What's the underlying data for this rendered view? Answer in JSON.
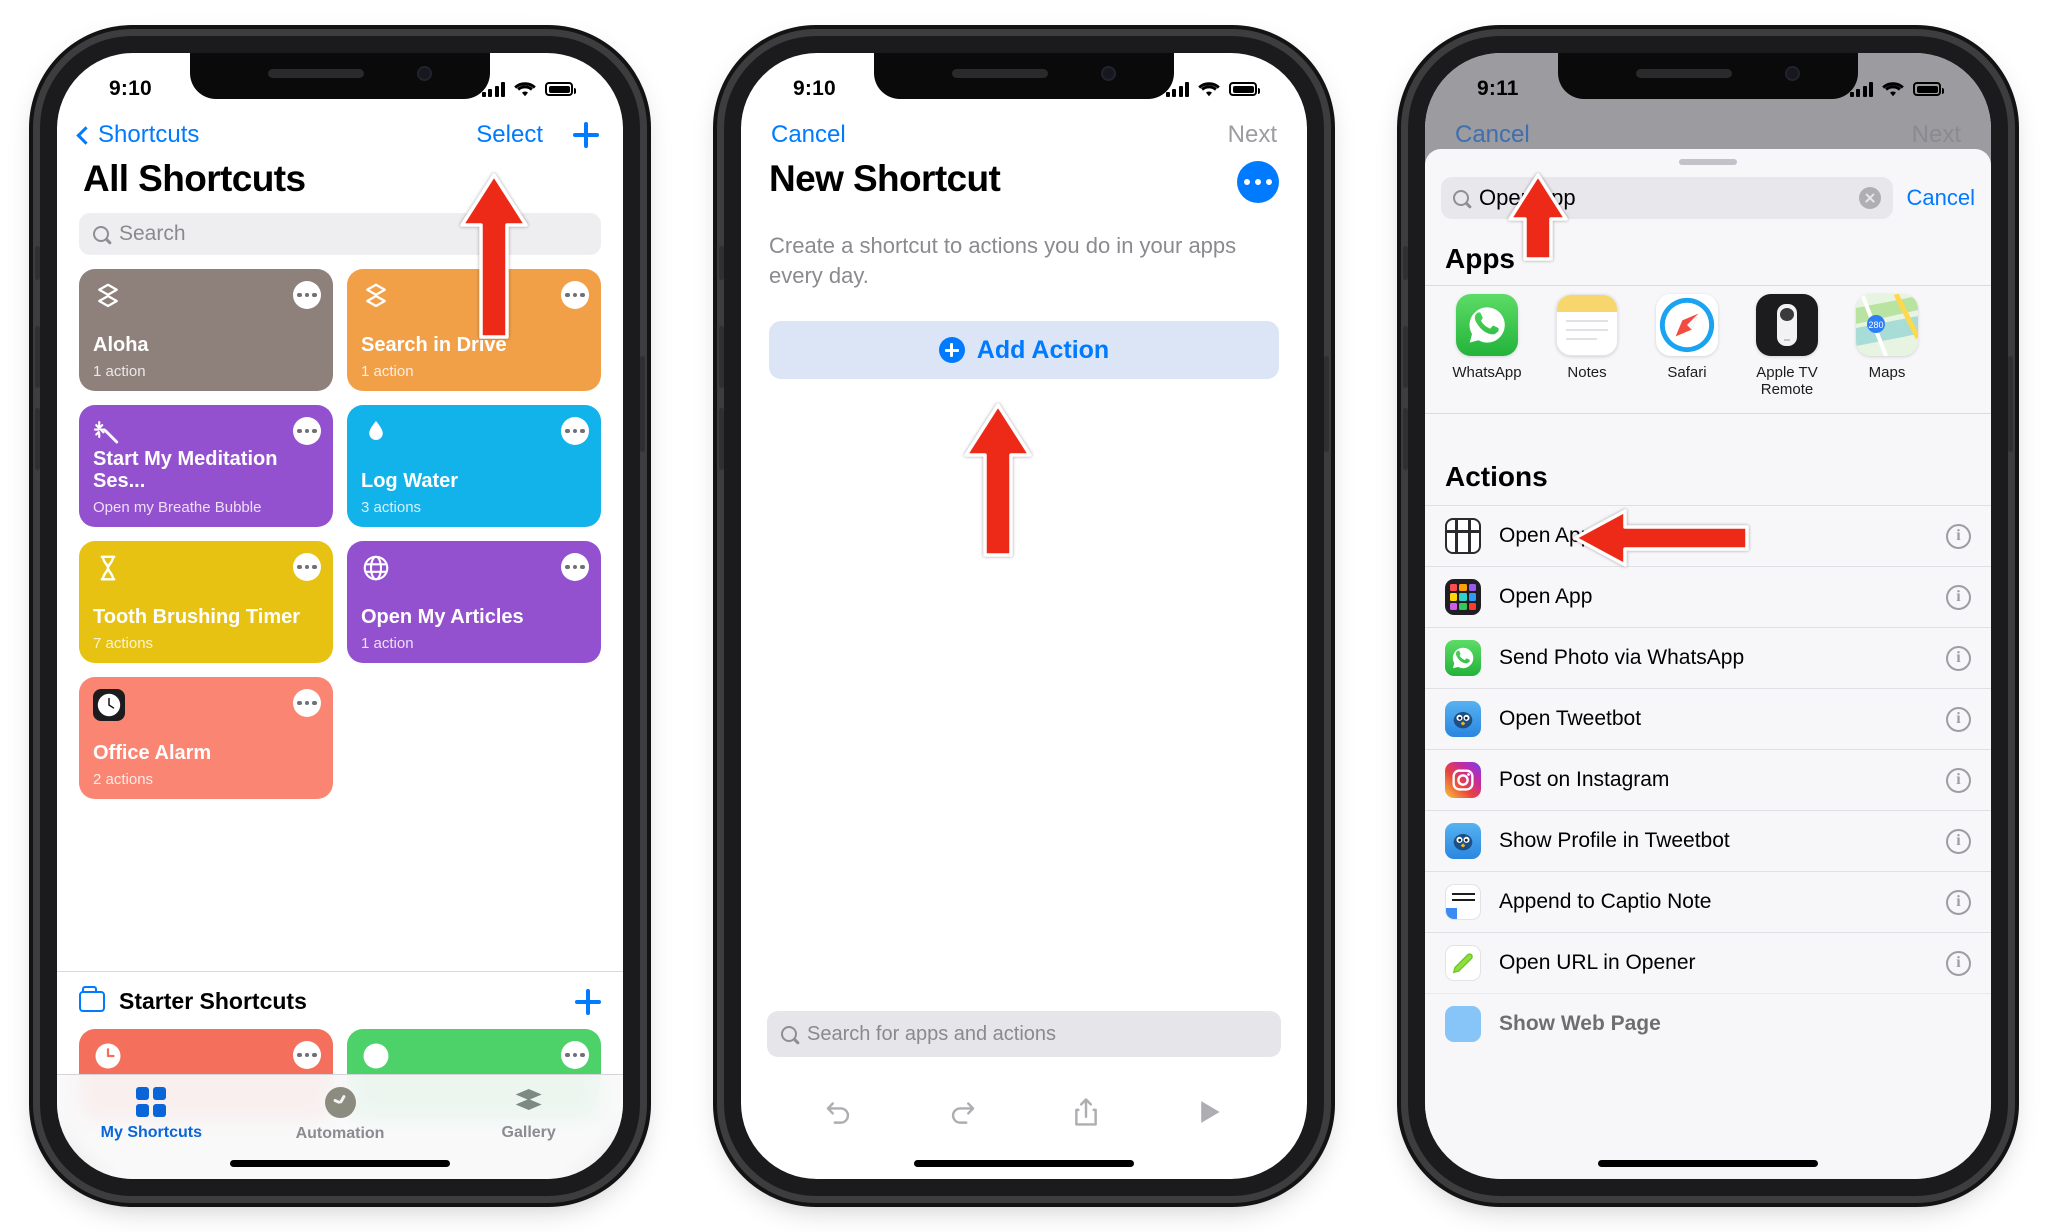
{
  "phone1": {
    "status": {
      "time": "9:10"
    },
    "nav": {
      "back_label": "Shortcuts",
      "select_label": "Select",
      "add_icon": "plus-icon"
    },
    "title": "All Shortcuts",
    "search_placeholder": "Search",
    "shortcuts": [
      {
        "name": "Aloha",
        "sub": "1 action",
        "color": "#8e817b",
        "icon": "layers-icon"
      },
      {
        "name": "Search in Drive",
        "sub": "1 action",
        "color": "#f2a048",
        "icon": "layers-icon"
      },
      {
        "name": "Start My Meditation Ses...",
        "sub": "Open my Breathe Bubble",
        "color": "#9451cf",
        "icon": "sparkle-wand-icon"
      },
      {
        "name": "Log Water",
        "sub": "3 actions",
        "color": "#12b2eb",
        "icon": "droplet-icon"
      },
      {
        "name": "Tooth Brushing Timer",
        "sub": "7 actions",
        "color": "#e8c212",
        "icon": "hourglass-icon"
      },
      {
        "name": "Open My Articles",
        "sub": "1 action",
        "color": "#9451cf",
        "icon": "globe-icon"
      },
      {
        "name": "Office Alarm",
        "sub": "2 actions",
        "color": "#f98572",
        "icon": "clock-app-icon"
      }
    ],
    "folder": {
      "label": "Starter Shortcuts",
      "icon": "folder-icon",
      "add_icon": "plus-icon"
    },
    "starter_tiles": [
      {
        "color": "#f4705c",
        "icon": "clock-icon"
      },
      {
        "color": "#4cd269",
        "icon": "circle-icon"
      }
    ],
    "tabs": [
      {
        "label": "My Shortcuts",
        "icon": "grid-icon",
        "active": true
      },
      {
        "label": "Automation",
        "icon": "clock-icon",
        "active": false
      },
      {
        "label": "Gallery",
        "icon": "layers-icon",
        "active": false
      }
    ]
  },
  "phone2": {
    "status": {
      "time": "9:10"
    },
    "nav": {
      "cancel_label": "Cancel",
      "next_label": "Next"
    },
    "title": "New Shortcut",
    "more_icon": "ellipsis-icon",
    "description": "Create a shortcut to actions you do in your apps every day.",
    "add_action_label": "Add Action",
    "search_placeholder": "Search for apps and actions",
    "toolbar": [
      {
        "icon": "undo-icon"
      },
      {
        "icon": "redo-icon"
      },
      {
        "icon": "share-icon"
      },
      {
        "icon": "play-icon"
      }
    ]
  },
  "phone3": {
    "status": {
      "time": "9:11"
    },
    "dim_nav": {
      "cancel_label": "Cancel",
      "next_label": "Next"
    },
    "search": {
      "value": "Open app",
      "search_icon": "search-icon",
      "clear_icon": "clear-icon"
    },
    "cancel_label": "Cancel",
    "apps_heading": "Apps",
    "apps": [
      {
        "name": "WhatsApp",
        "icon": "whatsapp-icon"
      },
      {
        "name": "Notes",
        "icon": "notes-icon"
      },
      {
        "name": "Safari",
        "icon": "safari-icon"
      },
      {
        "name": "Apple TV Remote",
        "icon": "apple-tv-remote-icon"
      },
      {
        "name": "Maps",
        "icon": "maps-icon"
      }
    ],
    "actions_heading": "Actions",
    "actions": [
      {
        "name": "Open App on Apple TV",
        "icon": "apple-tv-icon",
        "info_icon": "info-icon"
      },
      {
        "name": "Open App",
        "icon": "app-grid-icon",
        "info_icon": "info-icon"
      },
      {
        "name": "Send Photo via WhatsApp",
        "icon": "whatsapp-icon",
        "info_icon": "info-icon"
      },
      {
        "name": "Open Tweetbot",
        "icon": "tweetbot-icon",
        "info_icon": "info-icon"
      },
      {
        "name": "Post on Instagram",
        "icon": "instagram-icon",
        "info_icon": "info-icon"
      },
      {
        "name": "Show Profile in Tweetbot",
        "icon": "tweetbot-icon",
        "info_icon": "info-icon"
      },
      {
        "name": "Append to Captio Note",
        "icon": "captio-icon",
        "info_icon": "info-icon"
      },
      {
        "name": "Open URL in Opener",
        "icon": "opener-icon",
        "info_icon": "info-icon"
      },
      {
        "name": "Show Web Page",
        "icon": "webpage-icon",
        "info_icon": "info-icon"
      }
    ]
  },
  "annotations": {
    "arrow_color": "#ed2a18",
    "arrows": [
      {
        "name": "arrow-to-add-shortcut",
        "target": "phone1 plus button"
      },
      {
        "name": "arrow-to-add-action",
        "target": "phone2 Add Action button"
      },
      {
        "name": "arrow-to-search-field",
        "target": "phone3 search field"
      },
      {
        "name": "arrow-to-open-app-action",
        "target": "phone3 Open App action row"
      }
    ]
  }
}
